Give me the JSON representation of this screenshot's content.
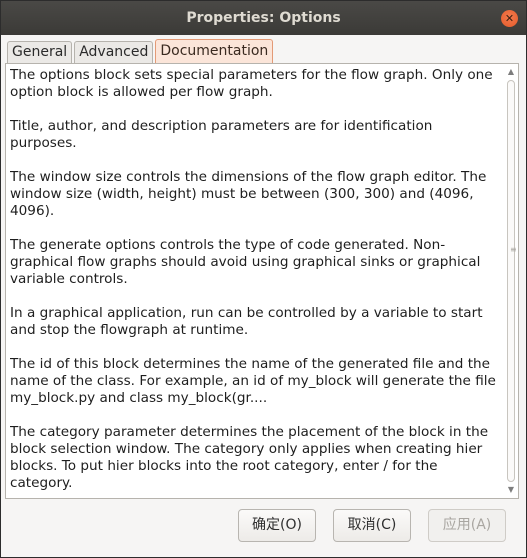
{
  "window": {
    "title": "Properties: Options"
  },
  "tabs": [
    {
      "label": "General",
      "active": false
    },
    {
      "label": "Advanced",
      "active": false
    },
    {
      "label": "Documentation",
      "active": true
    }
  ],
  "documentation": {
    "paragraphs": [
      "The options block sets special parameters for the flow graph. Only one option block is allowed per flow graph.",
      "Title, author, and description parameters are for identification purposes.",
      "The window size controls the dimensions of the flow graph editor. The window size (width, height) must be between (300, 300) and (4096, 4096).",
      "The generate options controls the type of code generated. Non-graphical flow graphs should avoid using graphical sinks or graphical variable controls.",
      "In a graphical application, run can be controlled by a variable to start and stop the flowgraph at runtime.",
      "The id of this block determines the name of the generated file and the name of the class. For example, an id of my_block will generate the file my_block.py and class my_block(gr....",
      "The category parameter determines the placement of the block in the block selection window. The category only applies when creating hier blocks. To put hier blocks into the root category, enter / for the category."
    ]
  },
  "buttons": {
    "ok": "确定(O)",
    "cancel": "取消(C)",
    "apply": "应用(A)"
  },
  "icons": {
    "close": "close-icon",
    "scroll_up": "chevron-up-icon",
    "scroll_down": "chevron-down-icon"
  },
  "colors": {
    "titlebar": "#3e3d39",
    "close_button": "#e95420",
    "active_tab_bg": "#fbe5d9",
    "active_tab_border": "#e39a76"
  }
}
